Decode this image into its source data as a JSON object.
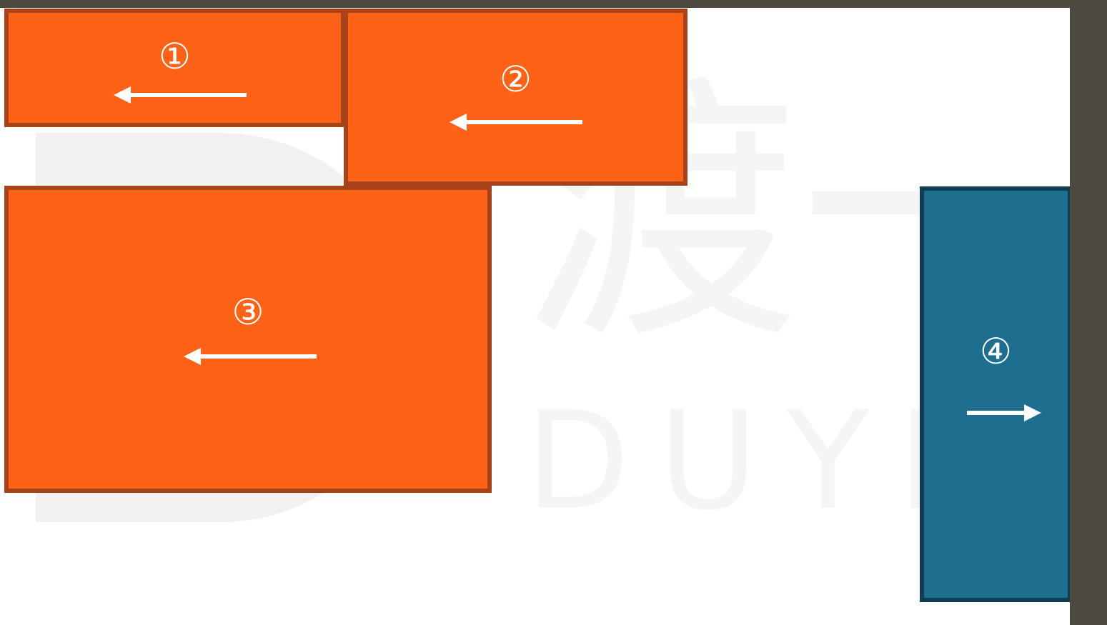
{
  "watermark": {
    "glyph": "渡一",
    "text": "DUYI EDU"
  },
  "colors": {
    "float_left_fill": "#fd6216",
    "float_left_border": "#a8421a",
    "float_right_fill": "#1e6f8f",
    "float_right_border": "#0f3d55",
    "arrow": "#ffffff"
  },
  "boxes": [
    {
      "label": "①",
      "direction": "left"
    },
    {
      "label": "②",
      "direction": "left"
    },
    {
      "label": "③",
      "direction": "left"
    },
    {
      "label": "④",
      "direction": "right"
    }
  ]
}
